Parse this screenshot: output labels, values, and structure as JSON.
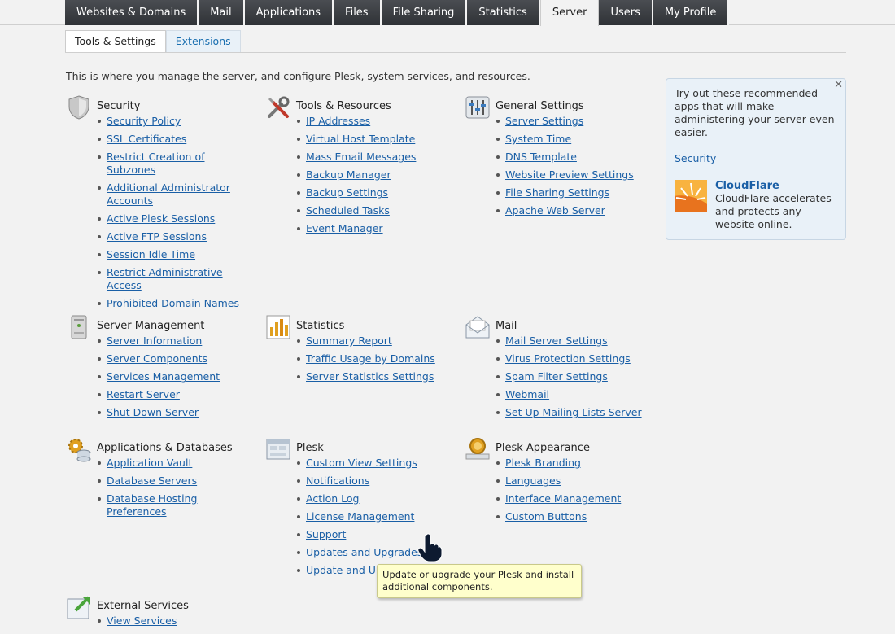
{
  "topnav": {
    "tabs": [
      {
        "label": "Websites & Domains"
      },
      {
        "label": "Mail"
      },
      {
        "label": "Applications"
      },
      {
        "label": "Files"
      },
      {
        "label": "File Sharing"
      },
      {
        "label": "Statistics"
      },
      {
        "label": "Server"
      },
      {
        "label": "Users"
      },
      {
        "label": "My Profile"
      }
    ],
    "active": "Server"
  },
  "subtabs": [
    {
      "label": "Tools & Settings"
    },
    {
      "label": "Extensions"
    }
  ],
  "intro": "This is where you manage the server, and configure Plesk, system services, and resources.",
  "sections": {
    "security": {
      "title": "Security",
      "icon": "shield-icon",
      "links": [
        "Security Policy",
        "SSL Certificates",
        "Restrict Creation of Subzones",
        "Additional Administrator Accounts",
        "Active Plesk Sessions",
        "Active FTP Sessions",
        "Session Idle Time",
        "Restrict Administrative Access",
        "Prohibited Domain Names"
      ]
    },
    "tools": {
      "title": "Tools & Resources",
      "icon": "tools-icon",
      "links": [
        "IP Addresses",
        "Virtual Host Template",
        "Mass Email Messages",
        "Backup Manager",
        "Backup Settings",
        "Scheduled Tasks",
        "Event Manager"
      ]
    },
    "general": {
      "title": "General Settings",
      "icon": "sliders-icon",
      "links": [
        "Server Settings",
        "System Time",
        "DNS Template",
        "Website Preview Settings",
        "File Sharing Settings",
        "Apache Web Server"
      ]
    },
    "server_mgmt": {
      "title": "Server Management",
      "icon": "server-icon",
      "links": [
        "Server Information",
        "Server Components",
        "Services Management",
        "Restart Server",
        "Shut Down Server"
      ]
    },
    "statistics": {
      "title": "Statistics",
      "icon": "bar-chart-icon",
      "links": [
        "Summary Report",
        "Traffic Usage by Domains",
        "Server Statistics Settings"
      ]
    },
    "mail": {
      "title": "Mail",
      "icon": "envelope-icon",
      "links": [
        "Mail Server Settings",
        "Virus Protection Settings",
        "Spam Filter Settings",
        "Webmail",
        "Set Up Mailing Lists Server"
      ]
    },
    "apps_db": {
      "title": "Applications & Databases",
      "icon": "gear-database-icon",
      "links": [
        "Application Vault",
        "Database Servers",
        "Database Hosting Preferences"
      ]
    },
    "plesk": {
      "title": "Plesk",
      "icon": "window-icon",
      "links": [
        "Custom View Settings",
        "Notifications",
        "Action Log",
        "License Management",
        "Support",
        "Updates and Upgrades",
        "Update and Up"
      ]
    },
    "appearance": {
      "title": "Plesk Appearance",
      "icon": "award-icon",
      "links": [
        "Plesk Branding",
        "Languages",
        "Interface Management",
        "Custom Buttons"
      ]
    },
    "external": {
      "title": "External Services",
      "icon": "external-link-icon",
      "links": [
        "View Services"
      ]
    }
  },
  "promo": {
    "message": "Try out these recommended apps that will make administering your server even easier.",
    "category": "Security",
    "app_name": "CloudFlare",
    "app_desc": "CloudFlare accelerates and protects any website online.",
    "close": "✕"
  },
  "tooltip": "Update or upgrade your Plesk and install additional components."
}
